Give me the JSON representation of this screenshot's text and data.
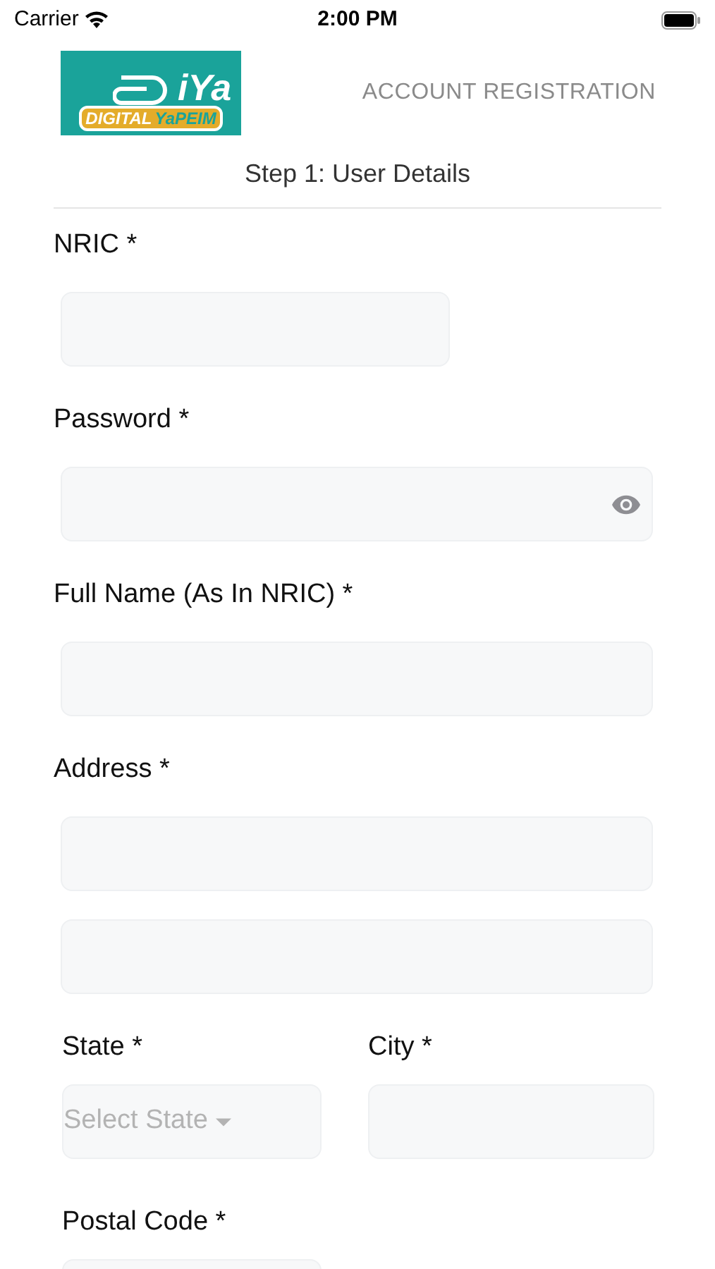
{
  "status_bar": {
    "carrier": "Carrier",
    "time": "2:00 PM"
  },
  "header": {
    "logo": {
      "mark": "iYa",
      "left": "DIGITAL",
      "right": "YaPEIM"
    },
    "title": "ACCOUNT REGISTRATION"
  },
  "step": "Step 1: User Details",
  "fields": [
    {
      "label": "NRIC *",
      "kind": "short"
    },
    {
      "label": "Password *",
      "kind": "password"
    },
    {
      "label": "Full Name (As In NRIC) *",
      "kind": "text"
    },
    {
      "label": "Address *",
      "kind": "address"
    }
  ],
  "row": [
    {
      "label": "State *",
      "kind": "select",
      "placeholder": "Select State"
    },
    {
      "label": "City *",
      "kind": "text"
    }
  ],
  "postal": {
    "label": "Postal Code *"
  }
}
